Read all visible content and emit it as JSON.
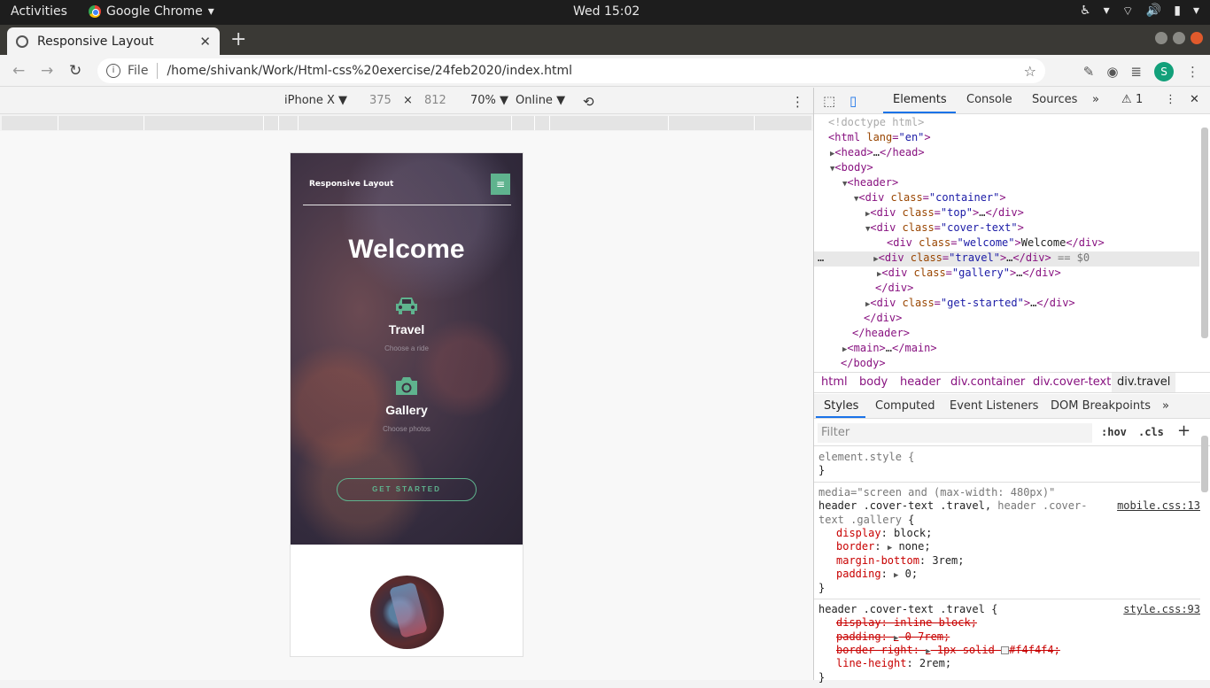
{
  "os": {
    "activities": "Activities",
    "app_name": "Google Chrome",
    "clock": "Wed 15:02"
  },
  "browser": {
    "tab_title": "Responsive Layout",
    "file_label": "File",
    "url": "/home/shivank/Work/Html-css%20exercise/24feb2020/index.html",
    "avatar_letter": "S"
  },
  "device_toolbar": {
    "device": "iPhone X ▼",
    "width": "375",
    "times": "×",
    "height": "812",
    "zoom": "70% ▼",
    "network": "Online ▼"
  },
  "page": {
    "brand": "Responsive Layout",
    "menu_icon": "≡",
    "welcome": "Welcome",
    "features": [
      {
        "title": "Travel",
        "subtitle": "Choose a ride",
        "icon": "car-icon"
      },
      {
        "title": "Gallery",
        "subtitle": "Choose photos",
        "icon": "camera-icon"
      }
    ],
    "cta": "GET STARTED"
  },
  "devtools": {
    "tabs": [
      "Elements",
      "Console",
      "Sources",
      "»"
    ],
    "warning_count": "1",
    "crumbs": [
      "html",
      "body",
      "header",
      "div.container",
      "div.cover-text",
      "div.travel"
    ],
    "style_tabs": [
      "Styles",
      "Computed",
      "Event Listeners",
      "DOM Breakpoints",
      "»"
    ],
    "filter_placeholder": "Filter",
    "hov": ":hov",
    "cls": ".cls",
    "plus": "+",
    "sources": [
      "mobile.css:13",
      "style.css:93"
    ],
    "dom_dots": "…"
  }
}
